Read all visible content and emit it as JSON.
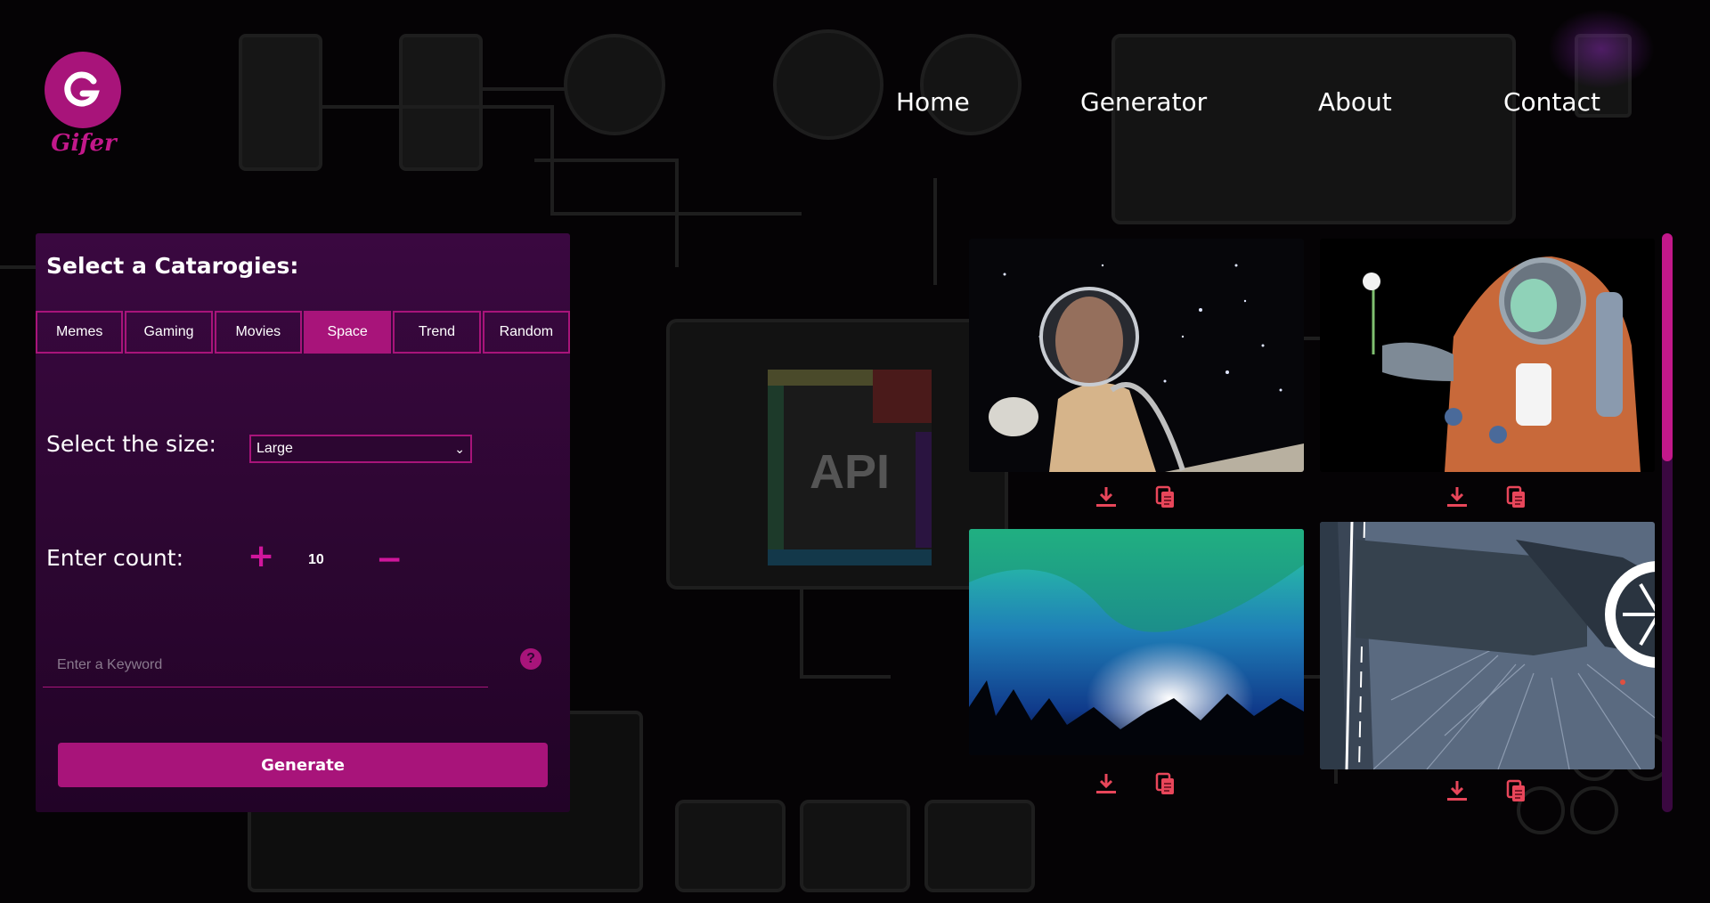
{
  "brand": {
    "name": "Gifer",
    "color": "#a8147a"
  },
  "nav": {
    "home": "Home",
    "generator": "Generator",
    "about": "About",
    "contact": "Contact"
  },
  "panel": {
    "title": "Select a Catarogies:",
    "categories": [
      "Memes",
      "Gaming",
      "Movies",
      "Space",
      "Trend",
      "Random"
    ],
    "active_category": "Space",
    "size_label": "Select the size:",
    "size_value": "Large",
    "count_label": "Enter count:",
    "count_plus": "+",
    "count_value": "10",
    "count_minus": "−",
    "keyword_placeholder": "Enter a Keyword",
    "help_symbol": "?",
    "generate_label": "Generate"
  },
  "gallery": {
    "items": [
      {
        "subject": "astronaut-helmet-space"
      },
      {
        "subject": "anime-astronaut-flower"
      },
      {
        "subject": "aurora-night-sky"
      },
      {
        "subject": "spaceship-hyperspace"
      }
    ],
    "icons": [
      "download-icon",
      "copy-icon"
    ]
  },
  "colors": {
    "accent": "#a8147a",
    "panel": "#2c0631",
    "icon": "#e8465a"
  }
}
